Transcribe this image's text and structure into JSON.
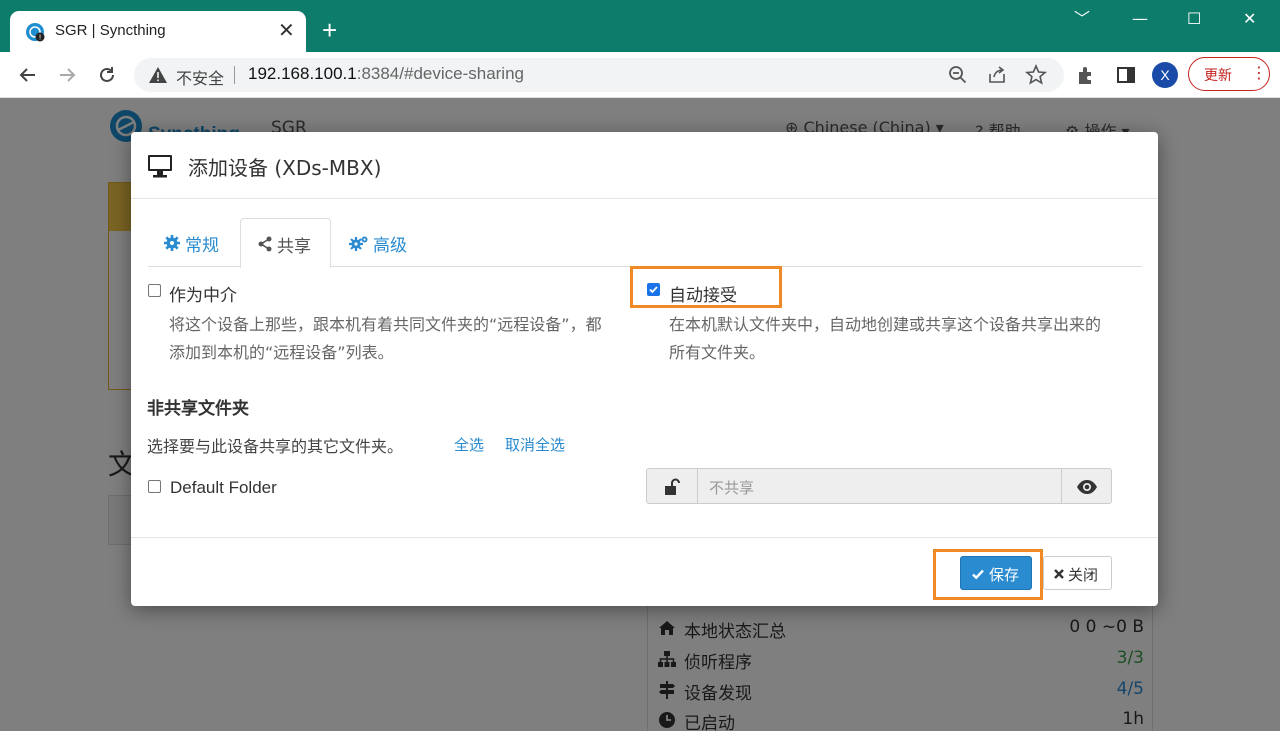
{
  "browser": {
    "tab_title": "SGR | Syncthing",
    "new_tab_symbol": "+",
    "insecure_label": "不安全",
    "url_host": "192.168.100.1",
    "url_rest": ":8384/#device-sharing",
    "avatar_letter": "X",
    "update_label": "更新",
    "window_controls": [
      "﹀",
      "—",
      "☐",
      "✕"
    ]
  },
  "page": {
    "brand": "Syncthing",
    "device_name": "SGR",
    "language": "Chinese (China)",
    "help": "帮助",
    "actions": "操作",
    "folders_heading": "文",
    "stats": [
      {
        "icon": "home-icon",
        "label": "本地状态汇总",
        "value": "0 0 ~0 B"
      },
      {
        "icon": "network-icon",
        "label": "侦听程序",
        "value": "3/3"
      },
      {
        "icon": "signpost-icon",
        "label": "设备发现",
        "value": "4/5"
      },
      {
        "icon": "clock-icon",
        "label": "已启动",
        "value": "1h"
      }
    ]
  },
  "modal": {
    "title": "添加设备 (XDs-MBX)",
    "tabs": [
      {
        "label": "常规",
        "icon": "gear-icon"
      },
      {
        "label": "共享",
        "icon": "share-icon"
      },
      {
        "label": "高级",
        "icon": "gears-icon"
      }
    ],
    "introducer": {
      "label": "作为中介",
      "help": "将这个设备上那些，跟本机有着共同文件夹的“远程设备”，都添加到本机的“远程设备”列表。",
      "checked": false
    },
    "auto_accept": {
      "label": "自动接受",
      "help": "在本机默认文件夹中，自动地创建或共享这个设备共享出来的所有文件夹。",
      "checked": true
    },
    "unshared_title": "非共享文件夹",
    "unshared_sub": "选择要与此设备共享的其它文件夹。",
    "select_all": "全选",
    "deselect_all": "取消全选",
    "folder_label": "Default Folder",
    "share_placeholder": "不共享",
    "save_label": "保存",
    "close_label": "关闭",
    "highlight_color": "#f08a24",
    "accent_color": "#2a8bd0"
  }
}
